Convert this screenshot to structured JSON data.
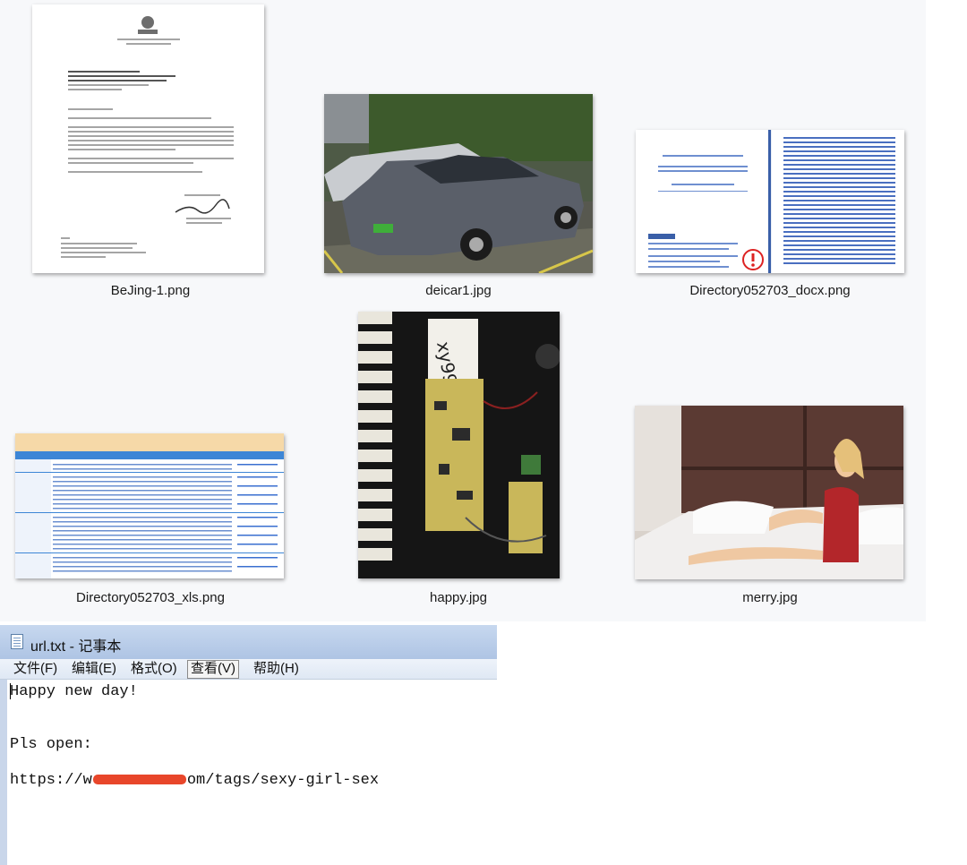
{
  "explorer": {
    "files": [
      {
        "name": "BeJing-1.png"
      },
      {
        "name": "deicar1.jpg"
      },
      {
        "name": "Directory052703_docx.png"
      },
      {
        "name": "Directory052703_xls.png"
      },
      {
        "name": "happy.jpg"
      },
      {
        "name": "merry.jpg"
      }
    ]
  },
  "notepad": {
    "title": "url.txt - 记事本",
    "menu": [
      "文件(F)",
      "编辑(E)",
      "格式(O)",
      "查看(V)",
      "帮助(H)"
    ],
    "active_menu": "查看(V)",
    "lines": [
      "Happy new day!",
      "Pls open:"
    ],
    "url_prefix": "https://w",
    "url_suffix": "om/tags/sexy-girl-sex"
  }
}
